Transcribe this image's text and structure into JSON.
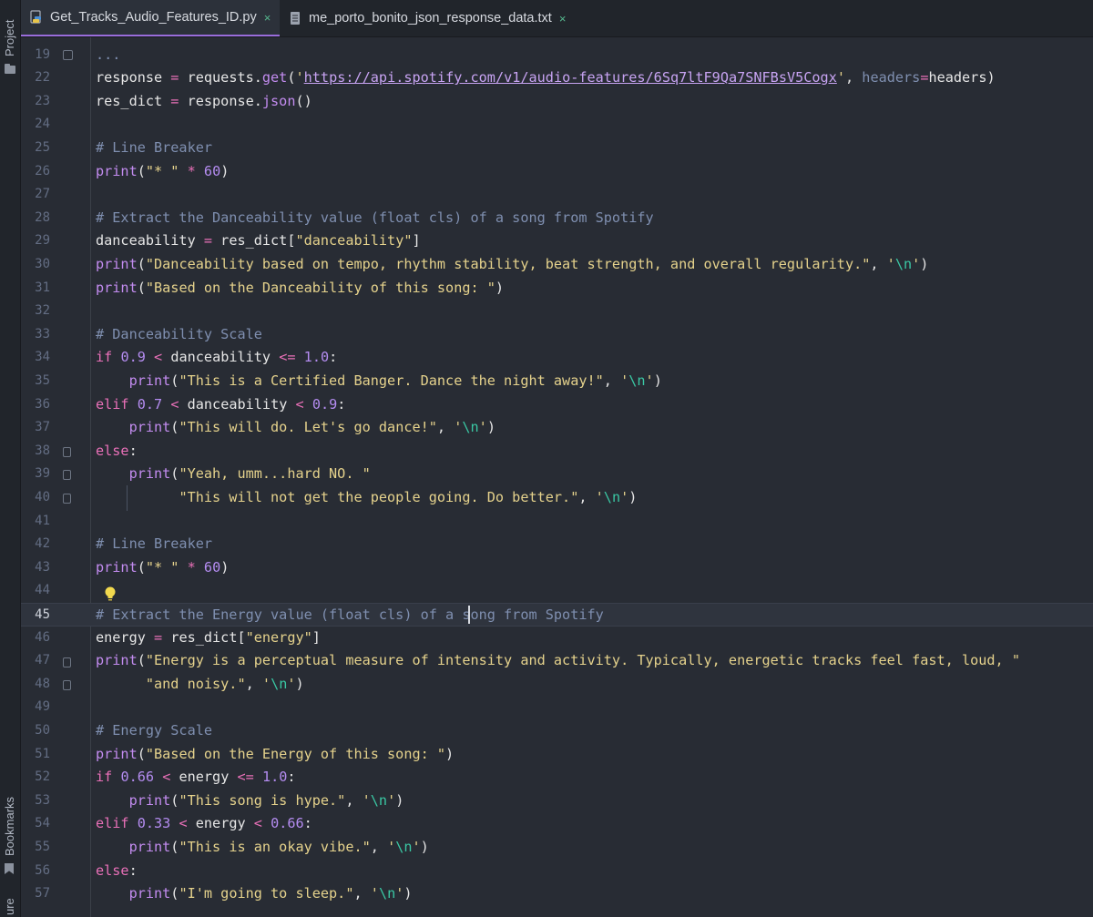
{
  "sidebar": {
    "project_label": "Project",
    "bookmarks_label": "Bookmarks",
    "structure_label_partial": "ure"
  },
  "tabs": [
    {
      "label": "Get_Tracks_Audio_Features_ID.py",
      "close": "×",
      "active": true
    },
    {
      "label": "me_porto_bonito_json_response_data.txt",
      "close": "×",
      "active": false
    }
  ],
  "current_line": "45",
  "lines": [
    {
      "n": "19",
      "html": "<span class='cm'>...</span>"
    },
    {
      "n": "22",
      "html": "response <span class='op'>=</span> requests.<span class='fn'>get</span>(<span class='st'>'</span><span class='url'>https://api.spotify.com/v1/audio-features/6Sq7ltF9Qa7SNFBsV5Cogx</span><span class='st'>'</span>, <span class='cm'>headers</span><span class='op'>=</span>headers)"
    },
    {
      "n": "23",
      "html": "res_dict <span class='op'>=</span> response.<span class='fn'>json</span>()"
    },
    {
      "n": "24",
      "html": ""
    },
    {
      "n": "25",
      "html": "<span class='cm'># Line Breaker</span>"
    },
    {
      "n": "26",
      "html": "<span class='fn'>print</span>(<span class='st'>\"* \"</span> <span class='op'>*</span> <span class='nm'>60</span>)"
    },
    {
      "n": "27",
      "html": ""
    },
    {
      "n": "28",
      "html": "<span class='cm'># Extract the Danceability value (float cls) of a song from Spotify</span>"
    },
    {
      "n": "29",
      "html": "danceability <span class='op'>=</span> res_dict[<span class='st'>\"danceability\"</span>]"
    },
    {
      "n": "30",
      "html": "<span class='fn'>print</span>(<span class='st'>\"Danceability based on tempo, rhythm stability, beat strength, and overall regularity.\"</span>, <span class='st'>'</span><span class='es'>\\n</span><span class='st'>'</span>)"
    },
    {
      "n": "31",
      "html": "<span class='fn'>print</span>(<span class='st'>\"Based on the Danceability of this song: \"</span>)"
    },
    {
      "n": "32",
      "html": ""
    },
    {
      "n": "33",
      "html": "<span class='cm'># Danceability Scale</span>"
    },
    {
      "n": "34",
      "html": "<span class='kw'>if</span> <span class='nm'>0.9</span> <span class='op'>&lt;</span> danceability <span class='op'>&lt;=</span> <span class='nm'>1.0</span>:"
    },
    {
      "n": "35",
      "html": "    <span class='fn'>print</span>(<span class='st'>\"This is a Certified Banger. Dance the night away!\"</span>, <span class='st'>'</span><span class='es'>\\n</span><span class='st'>'</span>)"
    },
    {
      "n": "36",
      "html": "<span class='kw'>elif</span> <span class='nm'>0.7</span> <span class='op'>&lt;</span> danceability <span class='op'>&lt;</span> <span class='nm'>0.9</span>:"
    },
    {
      "n": "37",
      "html": "    <span class='fn'>print</span>(<span class='st'>\"This will do. Let's go dance!\"</span>, <span class='st'>'</span><span class='es'>\\n</span><span class='st'>'</span>)"
    },
    {
      "n": "38",
      "html": "<span class='kw'>else</span>:"
    },
    {
      "n": "39",
      "html": "    <span class='fn'>print</span>(<span class='st'>\"Yeah, umm...hard NO. \"</span>"
    },
    {
      "n": "40",
      "html": "          <span class='st'>\"This will not get the people going. Do better.\"</span>, <span class='st'>'</span><span class='es'>\\n</span><span class='st'>'</span>)"
    },
    {
      "n": "41",
      "html": ""
    },
    {
      "n": "42",
      "html": "<span class='cm'># Line Breaker</span>"
    },
    {
      "n": "43",
      "html": "<span class='fn'>print</span>(<span class='st'>\"* \"</span> <span class='op'>*</span> <span class='nm'>60</span>)"
    },
    {
      "n": "44",
      "html": ""
    },
    {
      "n": "45",
      "html": "<span class='cm'># Extract the Energy value (float cls) of a song from Spotify</span>"
    },
    {
      "n": "46",
      "html": "energy <span class='op'>=</span> res_dict[<span class='st'>\"energy\"</span>]"
    },
    {
      "n": "47",
      "html": "<span class='fn'>print</span>(<span class='st'>\"Energy is a perceptual measure of intensity and activity. Typically, energetic tracks feel fast, loud, \"</span>"
    },
    {
      "n": "48",
      "html": "      <span class='st'>\"and noisy.\"</span>, <span class='st'>'</span><span class='es'>\\n</span><span class='st'>'</span>)"
    },
    {
      "n": "49",
      "html": ""
    },
    {
      "n": "50",
      "html": "<span class='cm'># Energy Scale</span>"
    },
    {
      "n": "51",
      "html": "<span class='fn'>print</span>(<span class='st'>\"Based on the Energy of this song: \"</span>)"
    },
    {
      "n": "52",
      "html": "<span class='kw'>if</span> <span class='nm'>0.66</span> <span class='op'>&lt;</span> energy <span class='op'>&lt;=</span> <span class='nm'>1.0</span>:"
    },
    {
      "n": "53",
      "html": "    <span class='fn'>print</span>(<span class='st'>\"This song is hype.\"</span>, <span class='st'>'</span><span class='es'>\\n</span><span class='st'>'</span>)"
    },
    {
      "n": "54",
      "html": "<span class='kw'>elif</span> <span class='nm'>0.33</span> <span class='op'>&lt;</span> energy <span class='op'>&lt;</span> <span class='nm'>0.66</span>:"
    },
    {
      "n": "55",
      "html": "    <span class='fn'>print</span>(<span class='st'>\"This is an okay vibe.\"</span>, <span class='st'>'</span><span class='es'>\\n</span><span class='st'>'</span>)"
    },
    {
      "n": "56",
      "html": "<span class='kw'>else</span>:"
    },
    {
      "n": "57",
      "html": "    <span class='fn'>print</span>(<span class='st'>\"I'm going to sleep.\"</span>, <span class='st'>'</span><span class='es'>\\n</span><span class='st'>'</span>)"
    }
  ]
}
